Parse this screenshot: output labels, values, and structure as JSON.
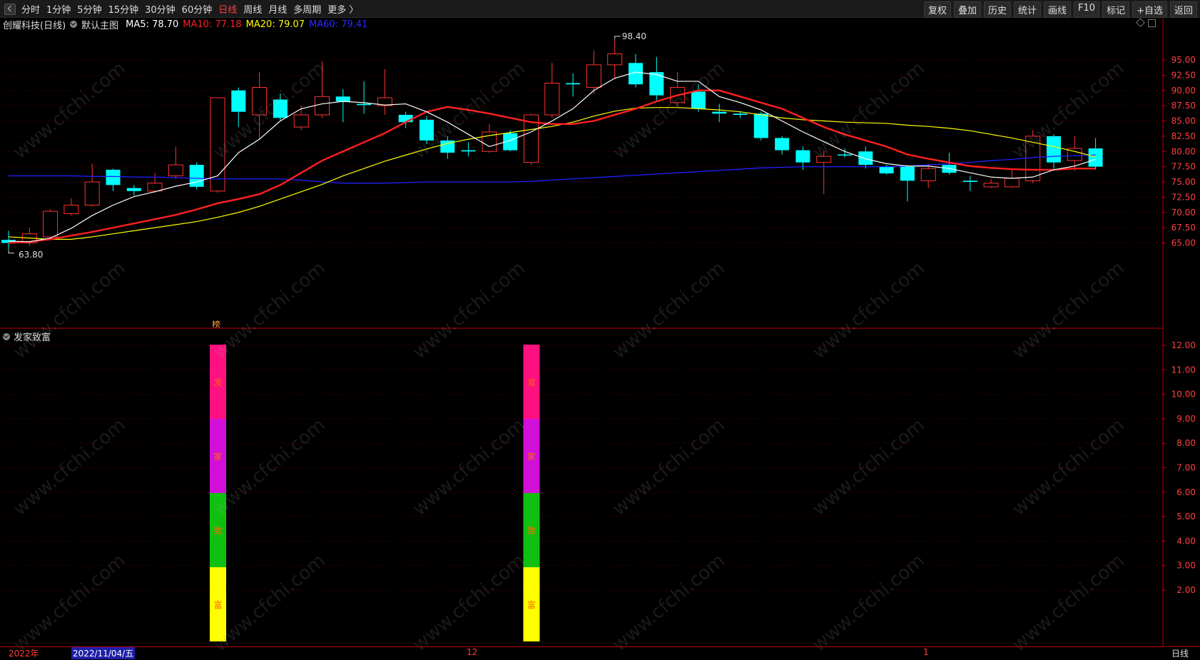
{
  "toolbar": {
    "periods": [
      "分时",
      "1分钟",
      "5分钟",
      "15分钟",
      "30分钟",
      "60分钟",
      "日线",
      "周线",
      "月线",
      "多周期",
      "更多 〉"
    ],
    "active_period": "日线",
    "tools": [
      "复权",
      "叠加",
      "历史",
      "统计",
      "画线",
      "F10",
      "标记",
      "+自选",
      "返回"
    ]
  },
  "info": {
    "stock": "创耀科技(日线)",
    "template": "默认主图",
    "ma5_label": "MA5: 78.70",
    "ma10_label": "MA10: 77.18",
    "ma20_label": "MA20: 79.07",
    "ma60_label": "MA60: 79.41",
    "colors": {
      "ma5": "#ffffff",
      "ma10": "#ff2020",
      "ma20": "#ffff00",
      "ma60": "#2020ff"
    }
  },
  "indicator": {
    "name": "发家致富",
    "chars": [
      "发",
      "家",
      "致",
      "富"
    ],
    "colors": [
      "#ff1080",
      "#d010d8",
      "#10c010",
      "#ffff00"
    ],
    "marker": "榜"
  },
  "annotations": {
    "high": "98.40",
    "low": "63.80"
  },
  "bottom": {
    "year": "2022年",
    "selected_date": "2022/11/04/五",
    "month12": "12",
    "month1": "1",
    "period": "日线"
  },
  "watermark": "www.cfchi.com",
  "chart_data": {
    "type": "candlestick",
    "price_axis": [
      "95.00",
      "92.50",
      "90.00",
      "87.50",
      "85.00",
      "82.50",
      "80.00",
      "77.50",
      "75.00",
      "72.50",
      "70.00",
      "67.50",
      "65.00"
    ],
    "indicator_axis": [
      "12.00",
      "11.00",
      "10.00",
      "9.00",
      "8.00",
      "7.00",
      "6.00",
      "5.00",
      "4.00",
      "3.00",
      "2.00"
    ],
    "candles": [
      {
        "o": 65.5,
        "c": 65.0,
        "h": 67.0,
        "l": 63.8
      },
      {
        "o": 65.0,
        "c": 66.5,
        "h": 67.5,
        "l": 64.5
      },
      {
        "o": 66.0,
        "c": 70.2,
        "h": 70.5,
        "l": 65.5
      },
      {
        "o": 69.8,
        "c": 71.2,
        "h": 72.3,
        "l": 69.5
      },
      {
        "o": 71.2,
        "c": 75.0,
        "h": 78.0,
        "l": 71.0
      },
      {
        "o": 77.0,
        "c": 74.5,
        "h": 77.2,
        "l": 73.5
      },
      {
        "o": 74.0,
        "c": 73.5,
        "h": 74.5,
        "l": 72.8
      },
      {
        "o": 73.5,
        "c": 74.8,
        "h": 76.5,
        "l": 73.2
      },
      {
        "o": 76.0,
        "c": 77.8,
        "h": 80.8,
        "l": 75.5
      },
      {
        "o": 77.8,
        "c": 74.2,
        "h": 78.2,
        "l": 73.8
      },
      {
        "o": 73.5,
        "c": 88.8,
        "h": 88.8,
        "l": 73.2
      },
      {
        "o": 90.0,
        "c": 86.5,
        "h": 90.5,
        "l": 84.0
      },
      {
        "o": 86.0,
        "c": 90.5,
        "h": 93.0,
        "l": 82.0
      },
      {
        "o": 88.5,
        "c": 85.5,
        "h": 89.5,
        "l": 85.0
      },
      {
        "o": 84.0,
        "c": 86.0,
        "h": 87.5,
        "l": 83.5
      },
      {
        "o": 86.0,
        "c": 89.0,
        "h": 94.8,
        "l": 85.5
      },
      {
        "o": 89.0,
        "c": 88.2,
        "h": 90.2,
        "l": 84.8
      },
      {
        "o": 87.8,
        "c": 87.6,
        "h": 91.5,
        "l": 86.2
      },
      {
        "o": 87.5,
        "c": 88.8,
        "h": 93.5,
        "l": 86.0
      },
      {
        "o": 86.0,
        "c": 84.8,
        "h": 86.5,
        "l": 83.8
      },
      {
        "o": 85.2,
        "c": 81.8,
        "h": 85.8,
        "l": 81.2
      },
      {
        "o": 81.8,
        "c": 79.8,
        "h": 82.5,
        "l": 78.8
      },
      {
        "o": 80.2,
        "c": 80.0,
        "h": 81.5,
        "l": 79.2
      },
      {
        "o": 80.0,
        "c": 83.2,
        "h": 84.5,
        "l": 79.8
      },
      {
        "o": 83.0,
        "c": 80.2,
        "h": 83.5,
        "l": 80.0
      },
      {
        "o": 78.2,
        "c": 86.0,
        "h": 86.2,
        "l": 77.8
      },
      {
        "o": 86.0,
        "c": 91.2,
        "h": 94.5,
        "l": 85.5
      },
      {
        "o": 91.2,
        "c": 91.0,
        "h": 92.8,
        "l": 89.0
      },
      {
        "o": 90.5,
        "c": 94.2,
        "h": 96.5,
        "l": 89.5
      },
      {
        "o": 94.2,
        "c": 96.0,
        "h": 98.4,
        "l": 92.0
      },
      {
        "o": 94.5,
        "c": 91.0,
        "h": 96.0,
        "l": 90.5
      },
      {
        "o": 93.0,
        "c": 89.2,
        "h": 95.5,
        "l": 88.2
      },
      {
        "o": 88.0,
        "c": 90.5,
        "h": 93.0,
        "l": 87.5
      },
      {
        "o": 89.8,
        "c": 87.0,
        "h": 91.0,
        "l": 86.5
      },
      {
        "o": 86.5,
        "c": 86.2,
        "h": 87.8,
        "l": 84.8
      },
      {
        "o": 86.2,
        "c": 86.0,
        "h": 86.5,
        "l": 85.5
      },
      {
        "o": 86.2,
        "c": 82.2,
        "h": 86.5,
        "l": 81.8
      },
      {
        "o": 82.2,
        "c": 80.2,
        "h": 82.5,
        "l": 79.5
      },
      {
        "o": 80.2,
        "c": 78.2,
        "h": 80.8,
        "l": 77.0
      },
      {
        "o": 78.2,
        "c": 79.2,
        "h": 80.0,
        "l": 73.0
      },
      {
        "o": 79.5,
        "c": 79.4,
        "h": 80.5,
        "l": 79.0
      },
      {
        "o": 80.0,
        "c": 77.8,
        "h": 80.8,
        "l": 77.2
      },
      {
        "o": 77.5,
        "c": 76.4,
        "h": 77.8,
        "l": 76.2
      },
      {
        "o": 77.5,
        "c": 75.2,
        "h": 77.8,
        "l": 71.8
      },
      {
        "o": 75.2,
        "c": 77.2,
        "h": 78.0,
        "l": 74.0
      },
      {
        "o": 77.8,
        "c": 76.5,
        "h": 79.8,
        "l": 76.2
      },
      {
        "o": 75.2,
        "c": 75.0,
        "h": 76.0,
        "l": 73.5
      },
      {
        "o": 74.2,
        "c": 74.8,
        "h": 75.5,
        "l": 74.0
      },
      {
        "o": 74.2,
        "c": 75.6,
        "h": 77.0,
        "l": 74.0
      },
      {
        "o": 75.2,
        "c": 82.5,
        "h": 83.5,
        "l": 74.8
      },
      {
        "o": 82.5,
        "c": 78.2,
        "h": 82.8,
        "l": 77.2
      },
      {
        "o": 78.5,
        "c": 80.5,
        "h": 82.5,
        "l": 76.8
      },
      {
        "o": 80.5,
        "c": 77.5,
        "h": 82.2,
        "l": 77.0
      }
    ],
    "ma5": [
      65.3,
      65.2,
      65.8,
      67.4,
      69.5,
      71.2,
      72.6,
      73.4,
      74.3,
      75.0,
      76.0,
      79.8,
      82.0,
      85.0,
      87.0,
      87.8,
      88.2,
      88.0,
      87.6,
      87.8,
      86.5,
      84.8,
      82.8,
      80.8,
      81.8,
      83.2,
      85.0,
      87.0,
      90.0,
      92.0,
      93.0,
      92.6,
      91.5,
      91.5,
      89.0,
      88.0,
      86.8,
      85.0,
      83.2,
      81.6,
      80.0,
      78.8,
      78.0,
      77.6,
      77.6,
      77.2,
      76.5,
      75.8,
      75.6,
      75.8,
      77.0,
      77.6,
      78.7
    ],
    "ma10": [
      65.0,
      65.2,
      65.6,
      66.2,
      66.8,
      67.5,
      68.2,
      68.9,
      69.6,
      70.5,
      71.5,
      72.2,
      73.0,
      74.5,
      76.5,
      78.5,
      80.0,
      81.5,
      83.0,
      84.8,
      86.5,
      87.3,
      86.8,
      86.2,
      85.5,
      84.8,
      84.5,
      84.5,
      85.0,
      86.0,
      87.0,
      88.2,
      89.2,
      90.0,
      90.0,
      89.0,
      88.0,
      87.0,
      85.5,
      84.0,
      82.8,
      81.8,
      80.8,
      79.5,
      78.8,
      78.2,
      77.6,
      77.3,
      77.1,
      77.0,
      77.0,
      77.2,
      77.2
    ],
    "ma20": [
      66.0,
      65.8,
      65.6,
      65.6,
      66.0,
      66.5,
      67.0,
      67.5,
      68.0,
      68.5,
      69.2,
      70.0,
      71.0,
      72.2,
      73.4,
      74.6,
      76.0,
      77.2,
      78.4,
      79.4,
      80.4,
      81.3,
      82.0,
      82.6,
      83.1,
      83.6,
      84.1,
      84.8,
      85.8,
      86.6,
      87.1,
      87.2,
      87.2,
      87.0,
      86.8,
      86.5,
      86.0,
      85.5,
      85.2,
      85.0,
      84.8,
      84.7,
      84.6,
      84.3,
      84.1,
      83.8,
      83.4,
      82.8,
      82.2,
      81.5,
      80.8,
      80.0,
      79.1
    ],
    "ma60": [
      76.0,
      76.0,
      76.0,
      76.0,
      75.9,
      75.9,
      75.8,
      75.8,
      75.7,
      75.6,
      75.5,
      75.5,
      75.5,
      75.5,
      75.3,
      75.0,
      74.8,
      74.8,
      74.8,
      74.9,
      75.0,
      75.0,
      75.0,
      75.0,
      75.0,
      75.1,
      75.3,
      75.5,
      75.7,
      75.9,
      76.1,
      76.3,
      76.5,
      76.7,
      76.9,
      77.1,
      77.3,
      77.4,
      77.5,
      77.5,
      77.5,
      77.5,
      77.5,
      77.6,
      77.8,
      78.0,
      78.2,
      78.5,
      78.7,
      79.0,
      79.2,
      79.3,
      79.4
    ]
  }
}
